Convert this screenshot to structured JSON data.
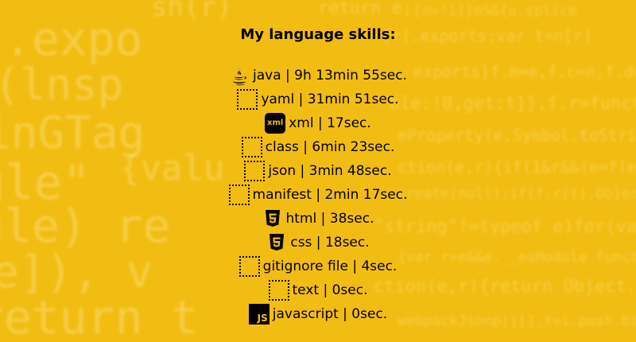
{
  "title": "My language skills:",
  "skills": [
    {
      "label": "java | 9h 13min 55sec.",
      "icon": "java-icon"
    },
    {
      "label": "yaml | 31min 51sec.",
      "icon": "file-icon"
    },
    {
      "label": "xml | 17sec.",
      "icon": "xml-icon",
      "icon_text": "xml"
    },
    {
      "label": "class | 6min 23sec.",
      "icon": "file-icon"
    },
    {
      "label": "json | 3min 48sec.",
      "icon": "file-icon"
    },
    {
      "label": "manifest | 2min 17sec.",
      "icon": "file-icon"
    },
    {
      "label": "html | 38sec.",
      "icon": "html5-icon"
    },
    {
      "label": "css | 18sec.",
      "icon": "css3-icon"
    },
    {
      "label": "gitignore file | 4sec.",
      "icon": "file-icon"
    },
    {
      "label": "text | 0sec.",
      "icon": "file-icon"
    },
    {
      "label": "javascript | 0sec.",
      "icon": "js-icon",
      "icon_text": "JS"
    }
  ],
  "colors": {
    "background": "#f2bd12",
    "text": "#000000"
  }
}
